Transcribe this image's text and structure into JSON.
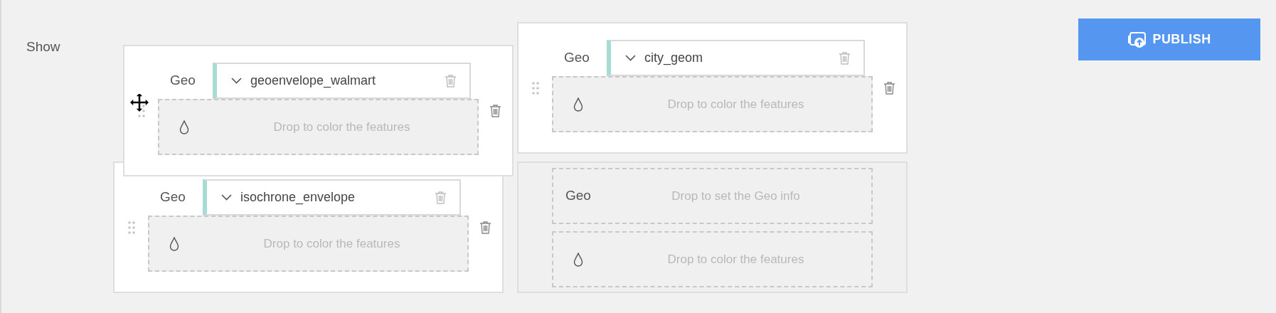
{
  "sidebar_label": "Show",
  "publish_button": {
    "label": "PUBLISH"
  },
  "layers": [
    {
      "kind": "filled",
      "dragging": true,
      "geo_label": "Geo",
      "geo_field": {
        "value": "geoenvelope_walmart"
      },
      "color_drop": {
        "placeholder": "Drop to color the features"
      }
    },
    {
      "kind": "filled",
      "dragging": false,
      "geo_label": "Geo",
      "geo_field": {
        "value": "city_geom"
      },
      "color_drop": {
        "placeholder": "Drop to color the features"
      }
    },
    {
      "kind": "filled",
      "dragging": false,
      "geo_label": "Geo",
      "geo_field": {
        "value": "isochrone_envelope"
      },
      "color_drop": {
        "placeholder": "Drop to color the features"
      }
    },
    {
      "kind": "empty",
      "dragging": false,
      "geo_label": "Geo",
      "geo_drop": {
        "placeholder": "Drop to set the Geo info"
      },
      "color_drop": {
        "placeholder": "Drop to color the features"
      }
    }
  ]
}
